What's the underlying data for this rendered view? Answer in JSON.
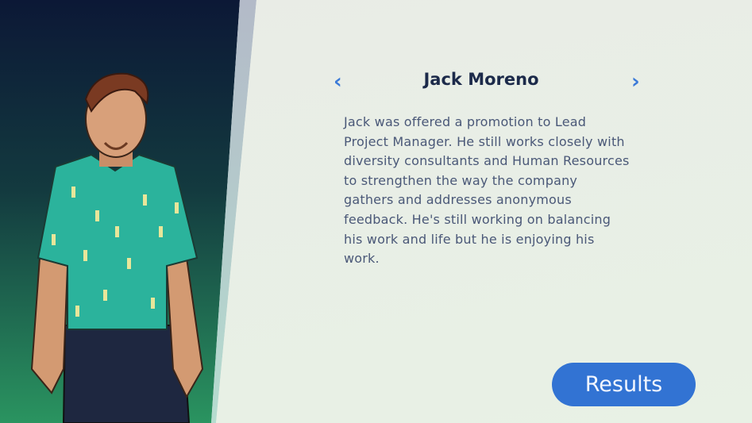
{
  "character": {
    "name": "Jack Moreno",
    "bio": "Jack was offered a promotion to Lead Project Manager. He still works closely with diversity consultants and Human Resources to strengthen the way the company gathers and addresses anonymous feedback. He's still working on balancing his work and life but he is enjoying his work."
  },
  "nav": {
    "prev_icon": "chevron-left-icon",
    "prev": "‹",
    "next_icon": "chevron-right-icon",
    "next": "›"
  },
  "actions": {
    "results_label": "Results"
  },
  "colors": {
    "accent": "#3273d3",
    "name_text": "#1c2a4a",
    "body_text": "#4a5878"
  }
}
